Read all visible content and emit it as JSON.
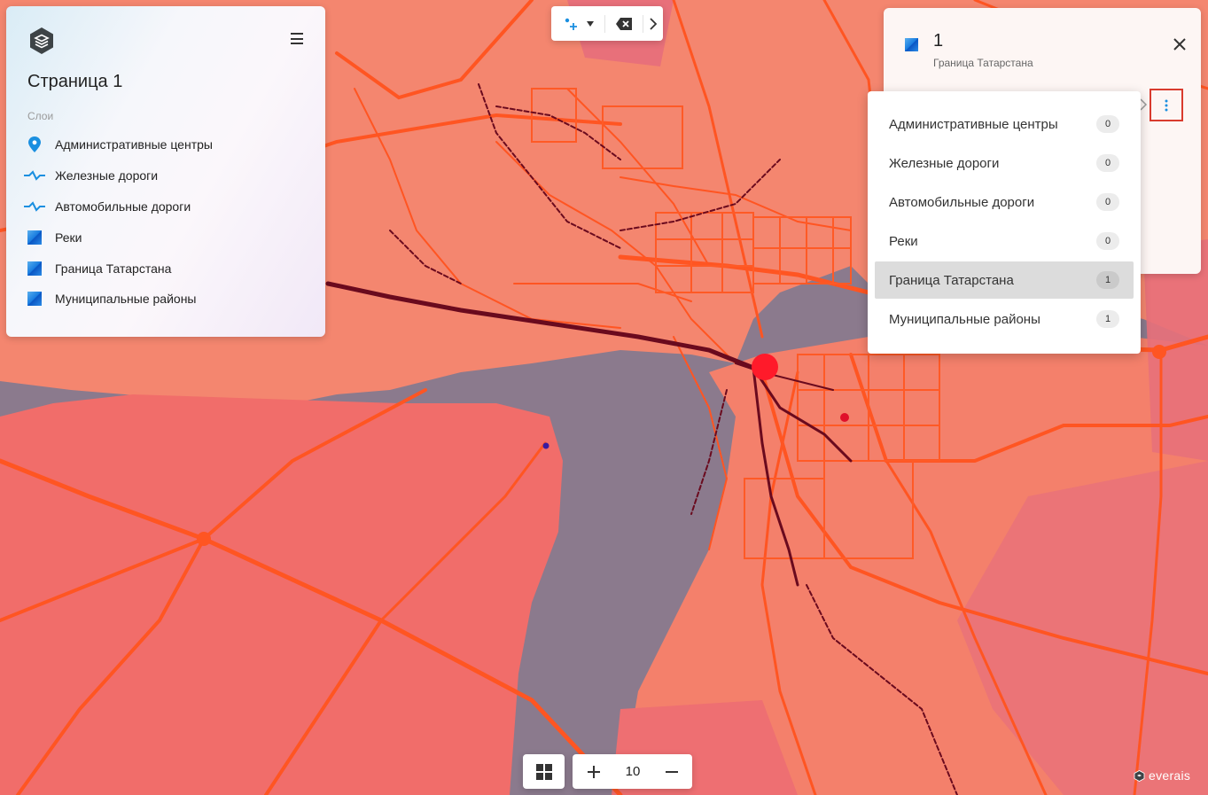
{
  "app": {
    "brand": "everais"
  },
  "left_panel": {
    "page_title": "Страница 1",
    "layers_caption": "Слои",
    "layers": [
      {
        "label": "Административные центры",
        "icon": "map-pin-icon"
      },
      {
        "label": "Железные дороги",
        "icon": "polyline-icon"
      },
      {
        "label": "Автомобильные дороги",
        "icon": "polyline-icon"
      },
      {
        "label": "Реки",
        "icon": "polygon-swatch-icon"
      },
      {
        "label": "Граница Татарстана",
        "icon": "polygon-swatch-icon"
      },
      {
        "label": "Муниципальные районы",
        "icon": "polygon-swatch-icon"
      }
    ]
  },
  "toolbar": {
    "tools": [
      "add-point-icon",
      "dropdown-arrow-icon",
      "backspace-icon",
      "chevron-right-icon"
    ]
  },
  "info_panel": {
    "title": "1",
    "subtitle": "Граница Татарстана"
  },
  "dropdown": {
    "items": [
      {
        "label": "Административные центры",
        "count": "0",
        "active": false
      },
      {
        "label": "Железные дороги",
        "count": "0",
        "active": false
      },
      {
        "label": "Автомобильные дороги",
        "count": "0",
        "active": false
      },
      {
        "label": "Реки",
        "count": "0",
        "active": false
      },
      {
        "label": "Граница Татарстана",
        "count": "1",
        "active": true
      },
      {
        "label": "Муниципальные районы",
        "count": "1",
        "active": false
      }
    ]
  },
  "zoom": {
    "level": "10"
  },
  "colors": {
    "land": "#f27f6b",
    "land_alt": "#ee6f72",
    "water": "#8b7a8d",
    "road": "#ff5522",
    "railway": "#6a0a1e",
    "accent": "#1a8fe0",
    "highlight": "#d93b2e"
  }
}
